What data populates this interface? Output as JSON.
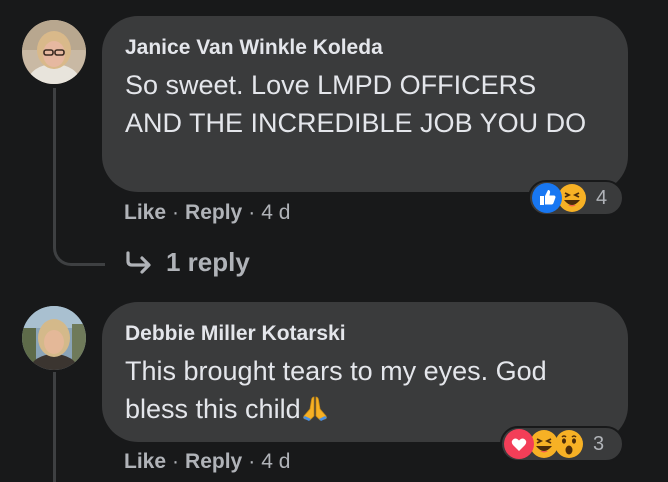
{
  "comments": [
    {
      "author": "Janice Van Winkle Koleda",
      "text": "So sweet. Love LMPD OFFICERS AND THE INCREDIBLE JOB YOU DO",
      "actions": {
        "like": "Like",
        "reply": "Reply",
        "time": "4 d"
      },
      "reactions": {
        "icons": [
          "like-icon",
          "haha-icon"
        ],
        "count": "4"
      },
      "replies_label": "1 reply"
    },
    {
      "author": "Debbie Miller Kotarski",
      "text": "This brought tears to my eyes. God bless this child",
      "text_emoji": "folded-hands-icon",
      "actions": {
        "like": "Like",
        "reply": "Reply",
        "time": "4 d"
      },
      "reactions": {
        "icons": [
          "love-icon",
          "haha-icon",
          "wow-icon"
        ],
        "count": "3"
      }
    }
  ],
  "separator": "·",
  "colors": {
    "background": "#18191a",
    "bubble": "#3a3b3c",
    "text": "#e4e6eb",
    "secondary": "#b0b3b8",
    "like_blue": "#1877f2",
    "love_red": "#f33e58",
    "emoji_yellow": "#f7b125"
  }
}
